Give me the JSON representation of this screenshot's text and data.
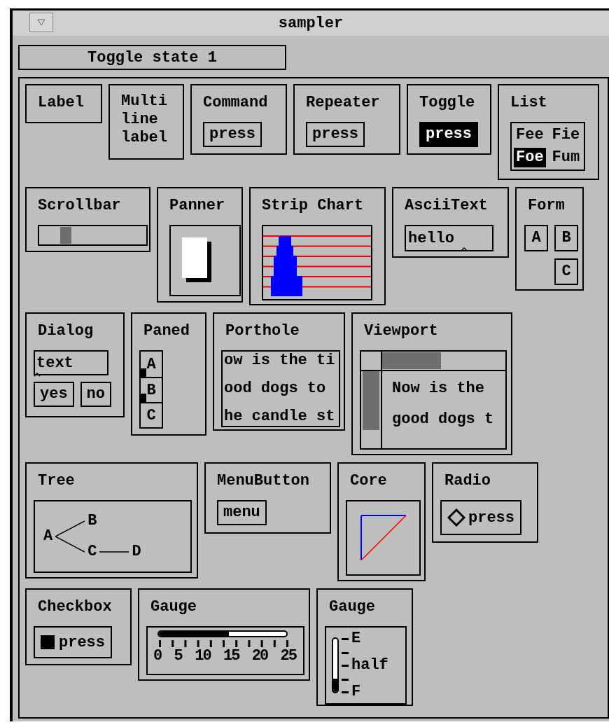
{
  "window": {
    "title": "sampler"
  },
  "status": {
    "text": "Toggle state 1"
  },
  "rows": [
    [
      {
        "kind": "label",
        "title": "Label"
      },
      {
        "kind": "multiline",
        "lines": [
          "Multi",
          "line",
          "label"
        ]
      },
      {
        "kind": "command",
        "title": "Command",
        "button": "press"
      },
      {
        "kind": "repeater",
        "title": "Repeater",
        "button": "press"
      },
      {
        "kind": "toggle",
        "title": "Toggle",
        "button": "press",
        "on": true
      },
      {
        "kind": "list",
        "title": "List",
        "items": [
          {
            "label": "Fee",
            "selected": false
          },
          {
            "label": "Fie",
            "selected": false
          },
          {
            "label": "Foe",
            "selected": true
          },
          {
            "label": "Fum",
            "selected": false
          }
        ]
      }
    ],
    [
      {
        "kind": "scrollbar",
        "title": "Scrollbar"
      },
      {
        "kind": "panner",
        "title": "Panner"
      },
      {
        "kind": "stripchart",
        "title": "Strip Chart"
      },
      {
        "kind": "asciitext",
        "title": "AsciiText",
        "value": "hello"
      },
      {
        "kind": "form",
        "title": "Form",
        "buttons": [
          "A",
          "B",
          "C"
        ]
      }
    ],
    [
      {
        "kind": "dialog",
        "title": "Dialog",
        "value": "text",
        "buttons": [
          "yes",
          "no"
        ]
      },
      {
        "kind": "paned",
        "title": "Paned",
        "panes": [
          "A",
          "B",
          "C"
        ]
      },
      {
        "kind": "porthole",
        "title": "Porthole",
        "lines": [
          "ow is the ti",
          "ood dogs to",
          "he candle st"
        ]
      },
      {
        "kind": "viewport",
        "title": "Viewport",
        "lines": [
          "Now is the",
          "good dogs t"
        ]
      }
    ],
    [
      {
        "kind": "tree",
        "title": "Tree",
        "root": {
          "label": "A",
          "children": [
            {
              "label": "B"
            },
            {
              "label": "C",
              "children": [
                {
                  "label": "D"
                }
              ]
            }
          ]
        }
      },
      {
        "kind": "menubutton",
        "title": "MenuButton",
        "button": "menu"
      },
      {
        "kind": "core",
        "title": "Core"
      },
      {
        "kind": "radio",
        "title": "Radio",
        "button": "press",
        "selected": false
      }
    ],
    [
      {
        "kind": "checkbox",
        "title": "Checkbox",
        "button": "press",
        "checked": true
      },
      {
        "kind": "hgauge",
        "title": "Gauge",
        "level": 0.55,
        "labels": [
          "0",
          "5",
          "10",
          "15",
          "20",
          "25"
        ]
      },
      {
        "kind": "vgauge",
        "title": "Gauge",
        "level": 0.25,
        "labels": [
          "E",
          "half",
          "F"
        ]
      }
    ]
  ]
}
